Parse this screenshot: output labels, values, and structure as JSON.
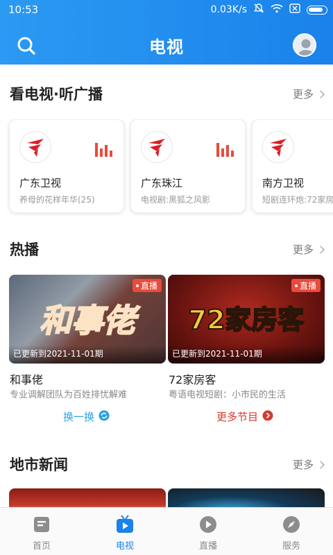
{
  "status_bar": {
    "time": "10:53",
    "speed": "0.03K/s"
  },
  "nav": {
    "title": "电视"
  },
  "sections": {
    "tv_radio": {
      "title": "看电视·听广播",
      "more": "更多"
    },
    "hot": {
      "title": "热播",
      "more": "更多"
    },
    "local_news": {
      "title": "地市新闻",
      "more": "更多"
    }
  },
  "channels": [
    {
      "name": "广东卫视",
      "program": "养母的花样年华(25)"
    },
    {
      "name": "广东珠江",
      "program": "电视剧:黑狐之风影"
    },
    {
      "name": "南方卫视",
      "program": "短剧连环炮:72家房客"
    }
  ],
  "hot_items": [
    {
      "title": "和事佬",
      "desc": "专业调解团队为百姓排忧解难",
      "update": "已更新到2021-11-01期",
      "badge": "直播",
      "thumb_text": "和事佬"
    },
    {
      "title": "72家房客",
      "desc": "粤语电视短剧：小市民的生活",
      "update": "已更新到2021-11-01期",
      "badge": "直播",
      "thumb_text": "72家房客"
    }
  ],
  "actions": {
    "refresh": "换一换",
    "more_programs": "更多节目"
  },
  "tabs": [
    {
      "label": "首页"
    },
    {
      "label": "电视"
    },
    {
      "label": "直播"
    },
    {
      "label": "服务"
    }
  ],
  "colors": {
    "brand_blue": "#1a82ea",
    "live_red": "#e94b3c",
    "logo_red": "#d81f26",
    "action_red": "#d63a2f"
  },
  "icons": [
    "search-icon",
    "avatar",
    "mute-icon",
    "wifi-icon",
    "battery-icon",
    "equalizer-icon",
    "refresh-icon",
    "arrow-right-icon",
    "home-icon",
    "tv-icon",
    "play-icon",
    "compass-icon"
  ]
}
